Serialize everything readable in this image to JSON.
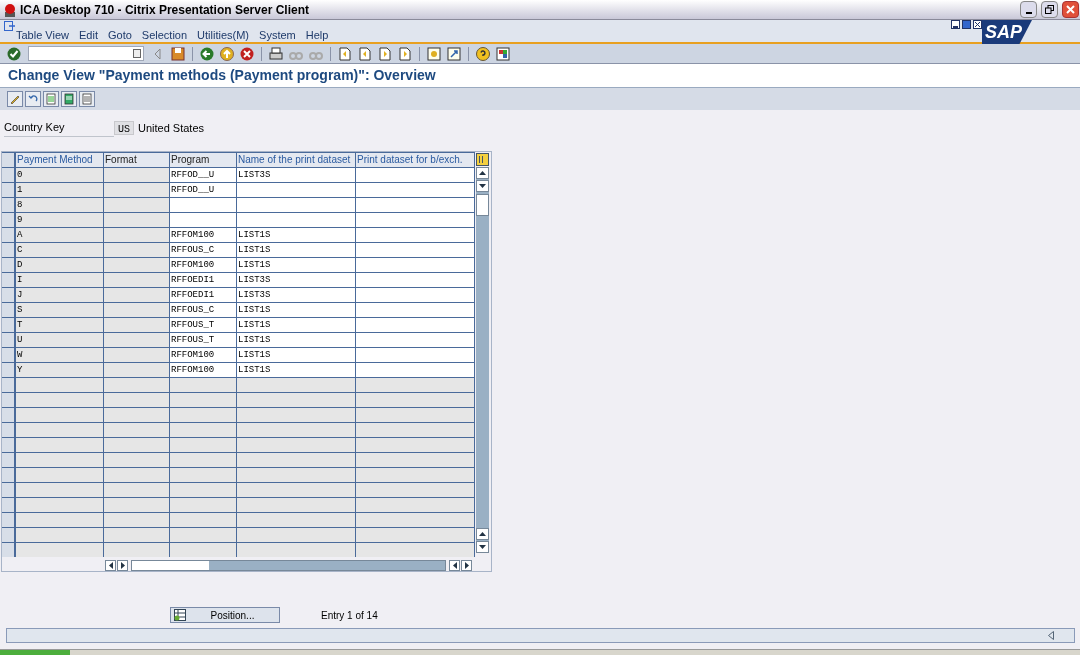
{
  "window": {
    "title": "ICA Desktop 710 - Citrix Presentation Server Client"
  },
  "menu": [
    "Table View",
    "Edit",
    "Goto",
    "Selection",
    "Utilities(M)",
    "System",
    "Help"
  ],
  "screen_title": "Change View \"Payment methods (Payment program)\": Overview",
  "country": {
    "label": "Country Key",
    "code": "US",
    "name": "United States"
  },
  "table": {
    "columns": [
      "Payment Method",
      "Format",
      "Program",
      "Name of the print dataset",
      "Print dataset for b/exch."
    ],
    "rows": [
      {
        "method": "0",
        "format": "",
        "program": "RFFOD__U",
        "dataset": "LIST3S",
        "bexch": ""
      },
      {
        "method": "1",
        "format": "",
        "program": "RFFOD__U",
        "dataset": "",
        "bexch": ""
      },
      {
        "method": "8",
        "format": "",
        "program": "",
        "dataset": "",
        "bexch": ""
      },
      {
        "method": "9",
        "format": "",
        "program": "",
        "dataset": "",
        "bexch": ""
      },
      {
        "method": "A",
        "format": "",
        "program": "RFFOM100",
        "dataset": "LIST1S",
        "bexch": ""
      },
      {
        "method": "C",
        "format": "",
        "program": "RFFOUS_C",
        "dataset": "LIST1S",
        "bexch": ""
      },
      {
        "method": "D",
        "format": "",
        "program": "RFFOM100",
        "dataset": "LIST1S",
        "bexch": ""
      },
      {
        "method": "I",
        "format": "",
        "program": "RFFOEDI1",
        "dataset": "LIST3S",
        "bexch": ""
      },
      {
        "method": "J",
        "format": "",
        "program": "RFFOEDI1",
        "dataset": "LIST3S",
        "bexch": ""
      },
      {
        "method": "S",
        "format": "",
        "program": "RFFOUS_C",
        "dataset": "LIST1S",
        "bexch": ""
      },
      {
        "method": "T",
        "format": "",
        "program": "RFFOUS_T",
        "dataset": "LIST1S",
        "bexch": ""
      },
      {
        "method": "U",
        "format": "",
        "program": "RFFOUS_T",
        "dataset": "LIST1S",
        "bexch": ""
      },
      {
        "method": "W",
        "format": "",
        "program": "RFFOM100",
        "dataset": "LIST1S",
        "bexch": ""
      },
      {
        "method": "Y",
        "format": "",
        "program": "RFFOM100",
        "dataset": "LIST1S",
        "bexch": ""
      }
    ]
  },
  "position_button": "Position...",
  "entry_info": "Entry 1 of 14",
  "logo": "SAP"
}
